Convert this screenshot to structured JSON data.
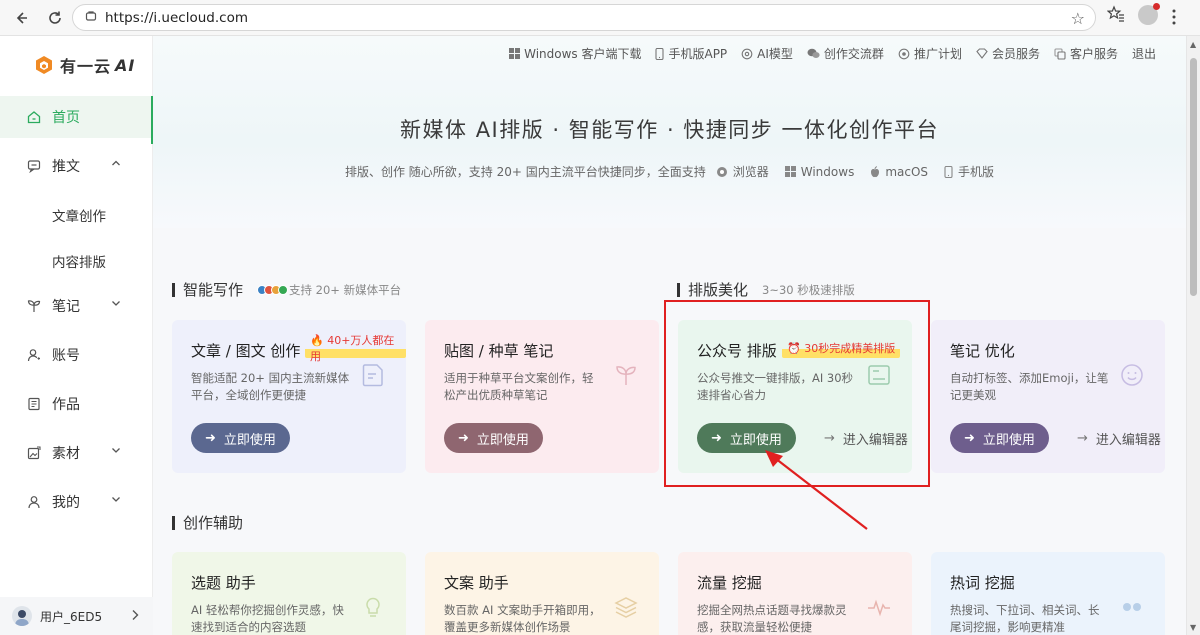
{
  "browser": {
    "url": "https://i.uecloud.com"
  },
  "sidebar": {
    "logo_text": "有一云",
    "logo_suffix": "AI",
    "items": [
      {
        "label": "首页",
        "icon": "home-icon",
        "active": true
      },
      {
        "label": "推文",
        "icon": "chat-icon",
        "expanded": true
      },
      {
        "label": "文章创作"
      },
      {
        "label": "内容排版"
      },
      {
        "label": "笔记",
        "icon": "sprout-icon"
      },
      {
        "label": "账号",
        "icon": "user-icon"
      },
      {
        "label": "作品",
        "icon": "works-icon"
      },
      {
        "label": "素材",
        "icon": "material-icon"
      },
      {
        "label": "我的",
        "icon": "person-icon"
      }
    ],
    "user_name": "用户_6ED5"
  },
  "top_links": [
    {
      "label": "Windows 客户端下载",
      "icon": "windows-icon"
    },
    {
      "label": "手机版APP",
      "icon": "phone-icon"
    },
    {
      "label": "AI模型",
      "icon": "ai-model-icon"
    },
    {
      "label": "创作交流群",
      "icon": "wechat-icon"
    },
    {
      "label": "推广计划",
      "icon": "promote-icon"
    },
    {
      "label": "会员服务",
      "icon": "vip-icon"
    },
    {
      "label": "客户服务",
      "icon": "service-icon"
    },
    {
      "label": "退出",
      "icon": ""
    }
  ],
  "hero": {
    "title": "新媒体 AI排版 · 智能写作 · 快捷同步 一体化创作平台",
    "subtitle": "排版、创作 随心所欲，支持 20+ 国内主流平台快捷同步，全面支持",
    "platforms": [
      {
        "label": "浏览器",
        "icon": "browser-icon"
      },
      {
        "label": "Windows",
        "icon": "windows-icon"
      },
      {
        "label": "macOS",
        "icon": "apple-icon"
      },
      {
        "label": "手机版",
        "icon": "phone-icon"
      }
    ]
  },
  "sections": {
    "writing": {
      "title": "智能写作",
      "desc": "支持 20+ 新媒体平台"
    },
    "layout": {
      "title": "排版美化",
      "desc": "3~30 秒极速排版"
    },
    "assist": {
      "title": "创作辅助"
    }
  },
  "cards": [
    {
      "title": "文章 / 图文 创作",
      "badge": "🔥 40+万人都在用",
      "desc": "智能适配 20+ 国内主流新媒体平台，全域创作更便捷",
      "button": "立即使用",
      "editor": ""
    },
    {
      "title": "贴图 / 种草 笔记",
      "badge": "",
      "desc": "适用于种草平台文案创作，轻松产出优质种草笔记",
      "button": "立即使用",
      "editor": ""
    },
    {
      "title": "公众号 排版",
      "badge": "⏰ 30秒完成精美排版",
      "desc": "公众号推文一键排版，AI 30秒速排省心省力",
      "button": "立即使用",
      "editor": "进入编辑器"
    },
    {
      "title": "笔记 优化",
      "badge": "",
      "desc": "自动打标签、添加Emoji，让笔记更美观",
      "button": "立即使用",
      "editor": "进入编辑器"
    }
  ],
  "assist_cards": [
    {
      "title": "选题 助手",
      "desc": "AI 轻松帮你挖掘创作灵感，快速找到适合的内容选题"
    },
    {
      "title": "文案 助手",
      "desc": "数百款 AI 文案助手开箱即用，覆盖更多新媒体创作场景"
    },
    {
      "title": "流量 挖掘",
      "desc": "挖掘全网热点话题寻找爆款灵感，获取流量轻松便捷"
    },
    {
      "title": "热词 挖掘",
      "desc": "热搜词、下拉词、相关词、长尾词挖掘，影响更精准"
    }
  ],
  "colors": {
    "accent": "#2bab5e",
    "annotation": "#e02020",
    "btn_blue": "#5b6890",
    "btn_rose": "#8f6670",
    "btn_green": "#4f7a5a",
    "btn_purple": "#6e5e8d"
  }
}
